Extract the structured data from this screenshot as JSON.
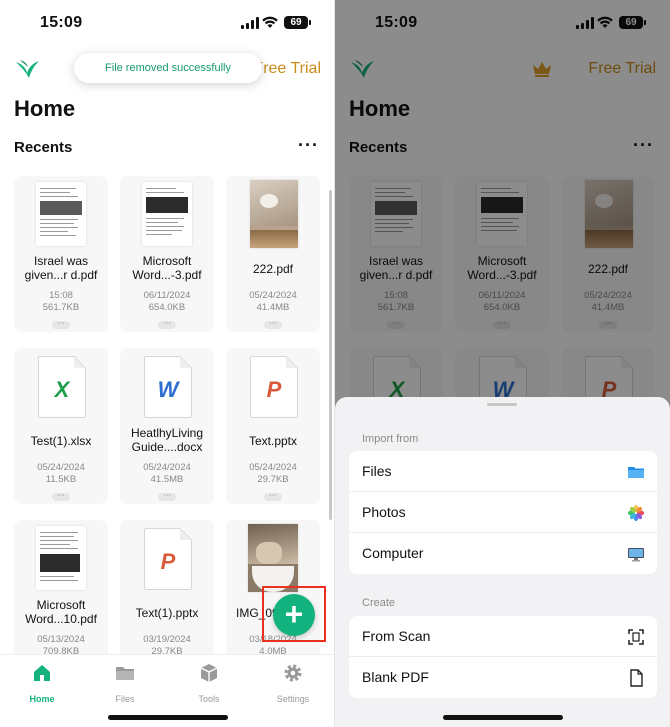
{
  "status_bar": {
    "time": "15:09",
    "battery": "69"
  },
  "header": {
    "free_trial": "Free Trial",
    "home_title": "Home",
    "recents_title": "Recents",
    "more": "···"
  },
  "toast": {
    "text": "File removed successfully"
  },
  "files": [
    {
      "name": "Israel was given...r d.pdf",
      "date": "15:08",
      "size": "561.7KB",
      "kind": "pdf-doc"
    },
    {
      "name": "Microsoft Word...-3.pdf",
      "date": "06/11/2024",
      "size": "654.0KB",
      "kind": "pdf-doc"
    },
    {
      "name": "222.pdf",
      "date": "05/24/2024",
      "size": "41.4MB",
      "kind": "pdf-photo"
    },
    {
      "name": "Test(1).xlsx",
      "date": "05/24/2024",
      "size": "11.5KB",
      "kind": "xlsx"
    },
    {
      "name": "HeatlhyLiving Guide....docx",
      "date": "05/24/2024",
      "size": "41.5MB",
      "kind": "docx"
    },
    {
      "name": "Text.pptx",
      "date": "05/24/2024",
      "size": "29.7KB",
      "kind": "pptx"
    },
    {
      "name": "Microsoft Word...10.pdf",
      "date": "05/13/2024",
      "size": "709.8KB",
      "kind": "pdf-doc"
    },
    {
      "name": "Text(1).pptx",
      "date": "03/19/2024",
      "size": "29.7KB",
      "kind": "pptx"
    },
    {
      "name": "IMG_09...",
      "date": "03/18/2024",
      "size": "4.0MB",
      "kind": "photo"
    }
  ],
  "file_glyphs": {
    "xlsx": "X",
    "docx": "W",
    "pptx": "P"
  },
  "card_more": "···",
  "fab": {
    "label": "+"
  },
  "tabs": [
    {
      "label": "Home",
      "icon": "home-icon",
      "active": true
    },
    {
      "label": "Files",
      "icon": "folder-icon",
      "active": false
    },
    {
      "label": "Tools",
      "icon": "box-icon",
      "active": false
    },
    {
      "label": "Settings",
      "icon": "gear-icon",
      "active": false
    }
  ],
  "sheet": {
    "import_title": "Import from",
    "import_items": [
      {
        "label": "Files",
        "icon": "folder-icon"
      },
      {
        "label": "Photos",
        "icon": "photos-icon"
      },
      {
        "label": "Computer",
        "icon": "monitor-icon"
      }
    ],
    "create_title": "Create",
    "create_items": [
      {
        "label": "From Scan",
        "icon": "scan-icon"
      },
      {
        "label": "Blank PDF",
        "icon": "document-icon"
      }
    ]
  },
  "colors": {
    "accent": "#13b27e",
    "trial": "#c98c1a",
    "highlight": "#e8321e",
    "xlsx": "#1e9e4a",
    "docx": "#2d6fd0",
    "pptx": "#d95a3a"
  }
}
